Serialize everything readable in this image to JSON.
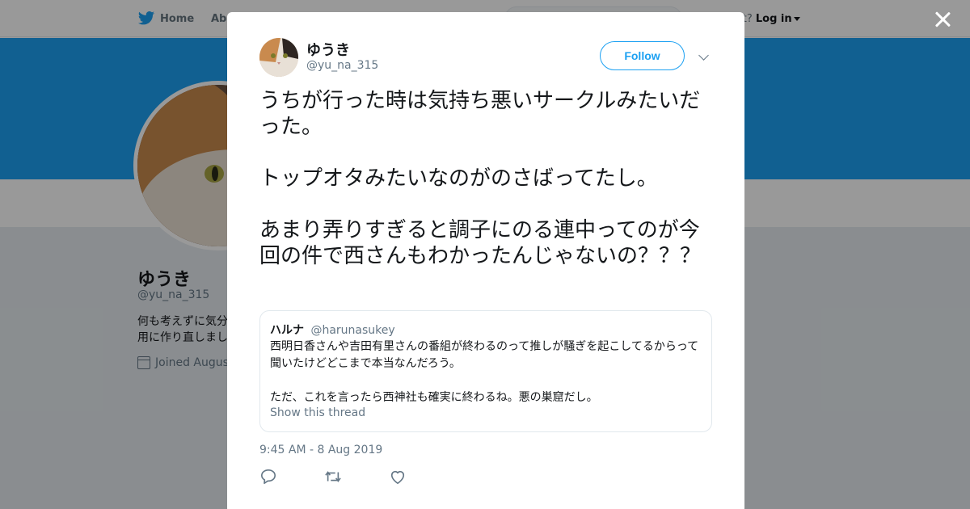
{
  "nav": {
    "home_label": "Home",
    "about_label": "Abo",
    "account_prompt": "ccount?",
    "login_label": "Log in"
  },
  "profile": {
    "name": "ゆうき",
    "handle": "@yu_na_315",
    "bio_line1": "何も考えずに気分",
    "bio_line2": "用に作り直しまし",
    "joined": "Joined August"
  },
  "tweet": {
    "author_name": "ゆうき",
    "author_handle": "@yu_na_315",
    "follow_label": "Follow",
    "text": "うちが行った時は気持ち悪いサークルみたいだった。\n\nトップオタみたいなのがのさばってたし。\n\nあまり弄りすぎると調子にのる連中ってのが今回の件で西さんもわかったんじゃないの？？？",
    "timestamp": "9:45 AM - 8 Aug 2019"
  },
  "quoted": {
    "name": "ハルナ",
    "handle": "@harunasukey",
    "text": "西明日香さんや吉田有里さんの番組が終わるのって推しが騒ぎを起こしてるからって聞いたけどどこまで本当なんだろう。\n\nただ、これを言ったら西神社も確実に終わるね。悪の巣窟だし。",
    "thread_link": "Show this thread"
  },
  "colors": {
    "accent": "#1da1f2",
    "secondary_text": "#657786",
    "border": "#e1e8ed"
  },
  "icons": [
    "twitter-bird-icon",
    "calendar-icon",
    "close-icon",
    "chevron-down-icon",
    "reply-icon",
    "retweet-icon",
    "like-icon"
  ]
}
